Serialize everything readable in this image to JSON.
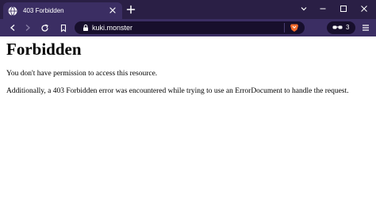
{
  "tab": {
    "title": "403 Forbidden",
    "favicon_icon": "globe-icon",
    "close_icon": "close-icon"
  },
  "new_tab_icon": "plus-icon",
  "window_controls": [
    "chevron-down-icon",
    "minimize-icon",
    "maximize-icon",
    "close-icon"
  ],
  "toolbar": {
    "buttons": [
      "back-icon",
      "forward-icon",
      "reload-icon",
      "bookmark-icon"
    ],
    "url": "kuki.monster",
    "lock_icon": "lock-icon",
    "shield_icon": "brave-shield-icon",
    "extension": {
      "icon": "glasses-icon",
      "count": "3"
    },
    "menu_icon": "menu-icon"
  },
  "page": {
    "title": "Forbidden",
    "message": "You don't have permission to access this resource.",
    "detail": "Additionally, a 403 Forbidden error was encountered while trying to use an ErrorDocument to handle the request."
  },
  "colors": {
    "tabstrip": "#2a1f45",
    "toolbar": "#3b2e63",
    "urlbar": "#170f2c",
    "brave_orange": "#f26a2b"
  }
}
